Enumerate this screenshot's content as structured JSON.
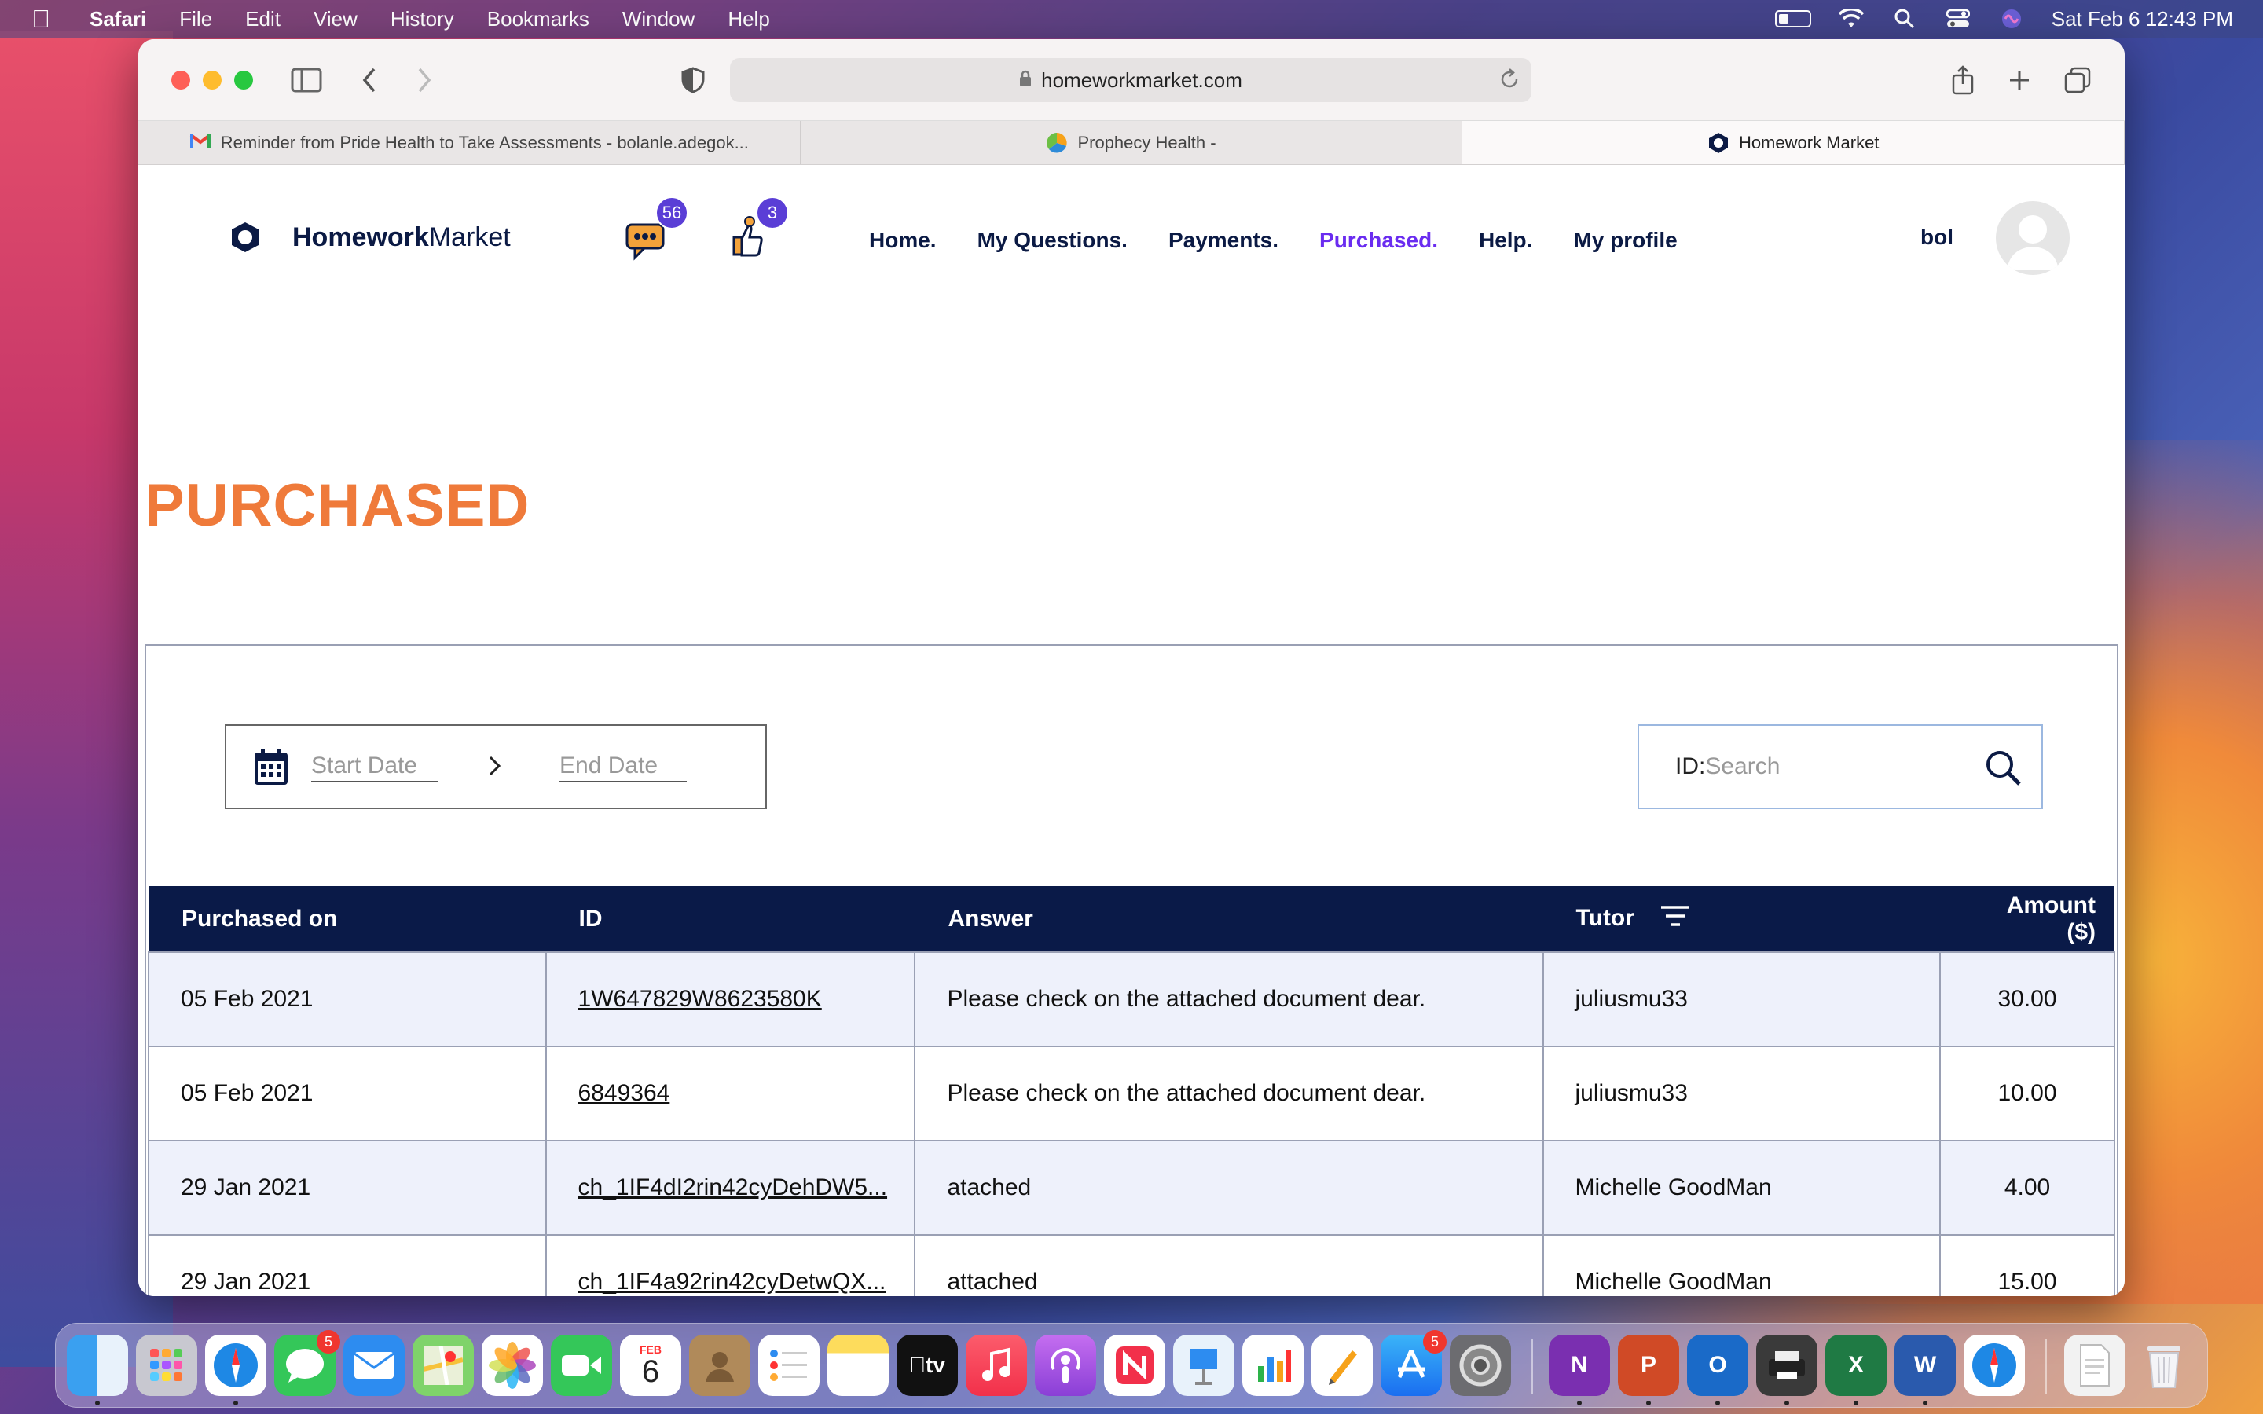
{
  "menubar": {
    "app_name": "Safari",
    "menus": [
      "File",
      "Edit",
      "View",
      "History",
      "Bookmarks",
      "Window",
      "Help"
    ],
    "datetime": "Sat Feb 6  12:43 PM"
  },
  "browser": {
    "url": "homeworkmarket.com",
    "tabs": [
      {
        "title": "Reminder from Pride Health to Take Assessments - bolanle.adegok..."
      },
      {
        "title": "Prophecy Health -"
      },
      {
        "title": "Homework Market"
      }
    ]
  },
  "site": {
    "logo_bold": "Homework",
    "logo_regular": "Market",
    "messages_badge": "56",
    "notifications_badge": "3",
    "nav": [
      "Home.",
      "My Questions.",
      "Payments.",
      "Purchased.",
      "Help.",
      "My profile"
    ],
    "active_nav": "Purchased.",
    "user_name": "bol"
  },
  "page": {
    "title": "PURCHASED",
    "start_date_placeholder": "Start Date",
    "end_date_placeholder": "End Date",
    "search_label": "ID:",
    "search_placeholder": "Search"
  },
  "table": {
    "headers": [
      "Purchased on",
      "ID",
      "Answer",
      "Tutor",
      "Amount ($)"
    ],
    "rows": [
      {
        "date": "05 Feb 2021",
        "id": "1W647829W8623580K",
        "answer": "Please check on the attached document dear.",
        "tutor": "juliusmu33",
        "amount": "30.00"
      },
      {
        "date": "05 Feb 2021",
        "id": "6849364",
        "answer": "Please check on the attached document dear.",
        "tutor": "juliusmu33",
        "amount": "10.00"
      },
      {
        "date": "29 Jan 2021",
        "id": "ch_1IF4dI2rin42cyDehDW5...",
        "answer": "atached",
        "tutor": "Michelle GoodMan",
        "amount": "4.00"
      },
      {
        "date": "29 Jan 2021",
        "id": "ch_1IF4a92rin42cyDetwQX...",
        "answer": "attached",
        "tutor": "Michelle GoodMan",
        "amount": "15.00"
      }
    ]
  },
  "dock": {
    "messages_badge": "5",
    "appstore_badge": "5",
    "calendar_month": "FEB",
    "calendar_day": "6"
  },
  "colors": {
    "accent": "#6a2cf0",
    "title_orange": "#ef7a3a",
    "navy": "#0a1a48"
  }
}
